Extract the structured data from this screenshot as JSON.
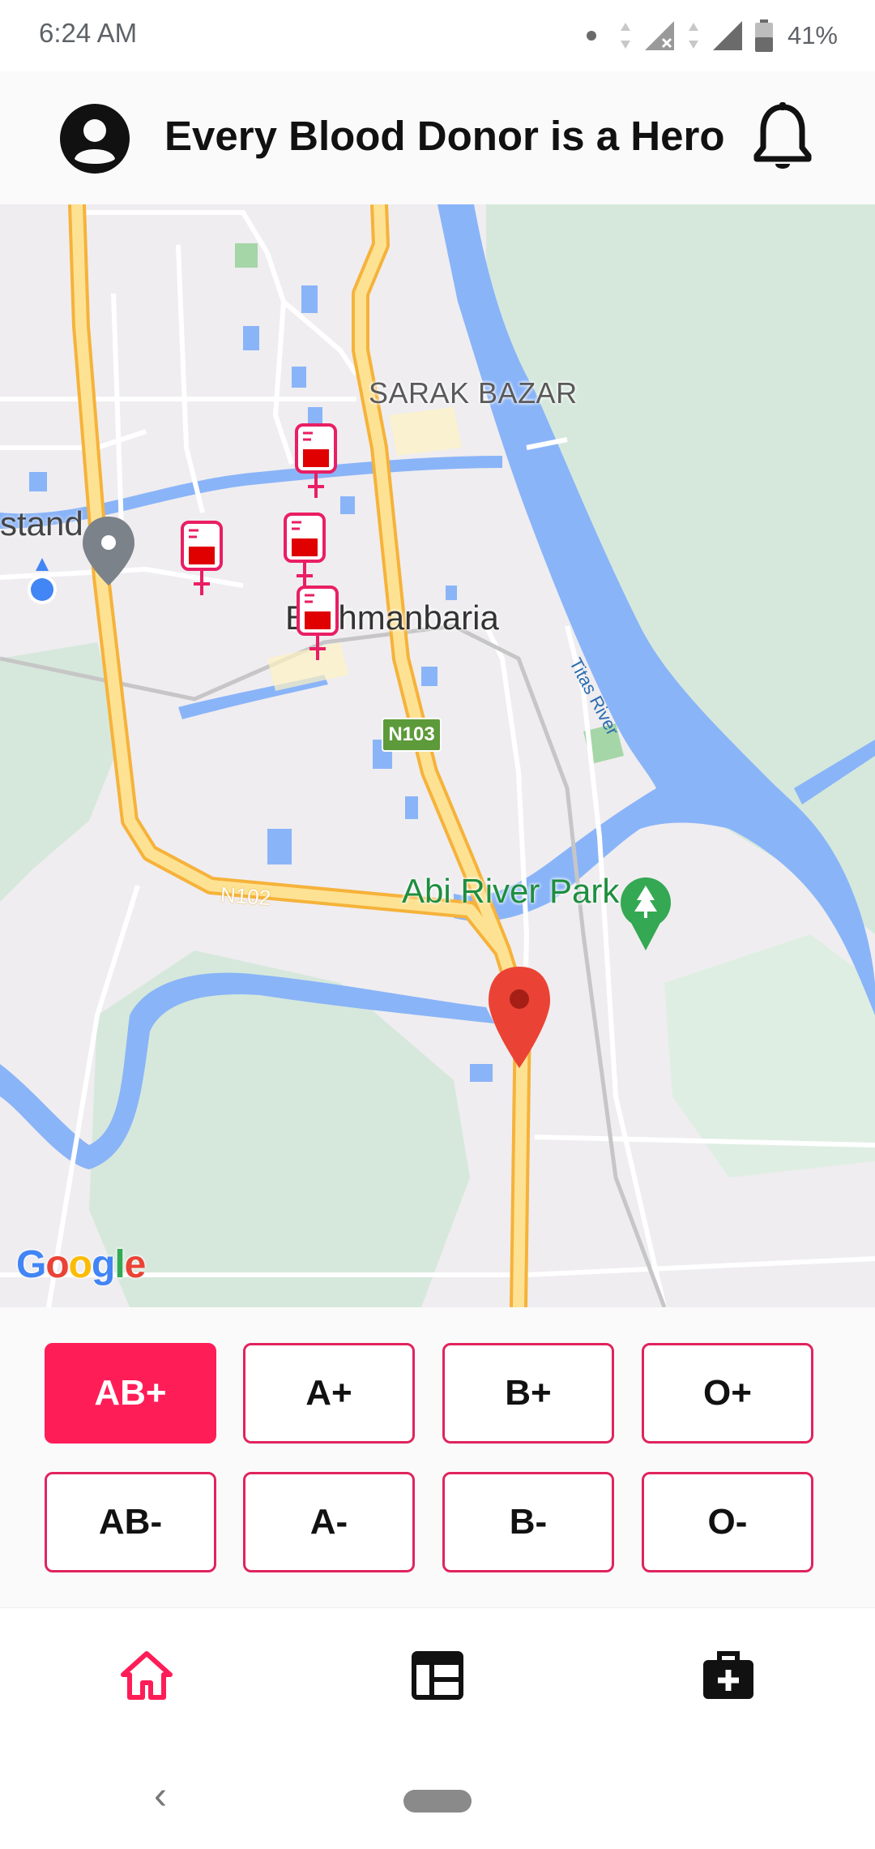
{
  "status_bar": {
    "time": "6:24 AM",
    "battery": "41%"
  },
  "header": {
    "title": "Every Blood Donor is a Hero",
    "profile_icon": "account-circle-icon",
    "notification_icon": "bell-icon"
  },
  "map": {
    "labels": {
      "sarak_bazar": "SARAK BAZAR",
      "stand": "stand",
      "brahmanbaria": "Brahmanbaria",
      "abi_river_park": "Abi River Park",
      "titas_river": "Titas River",
      "road_shield": "N103",
      "road_label": "N102"
    },
    "attribution": "Google"
  },
  "blood_groups": {
    "selected": "AB+",
    "row1": [
      "AB+",
      "A+",
      "B+",
      "O+"
    ],
    "row2": [
      "AB-",
      "A-",
      "B-",
      "O-"
    ]
  },
  "bottom_nav": {
    "items": [
      "home-icon",
      "feed-icon",
      "medical-kit-icon"
    ],
    "active": "home-icon"
  },
  "colors": {
    "accent": "#ff1d58",
    "border": "#e0245e",
    "road": "#fbc02d",
    "water": "#8ab4f8"
  }
}
